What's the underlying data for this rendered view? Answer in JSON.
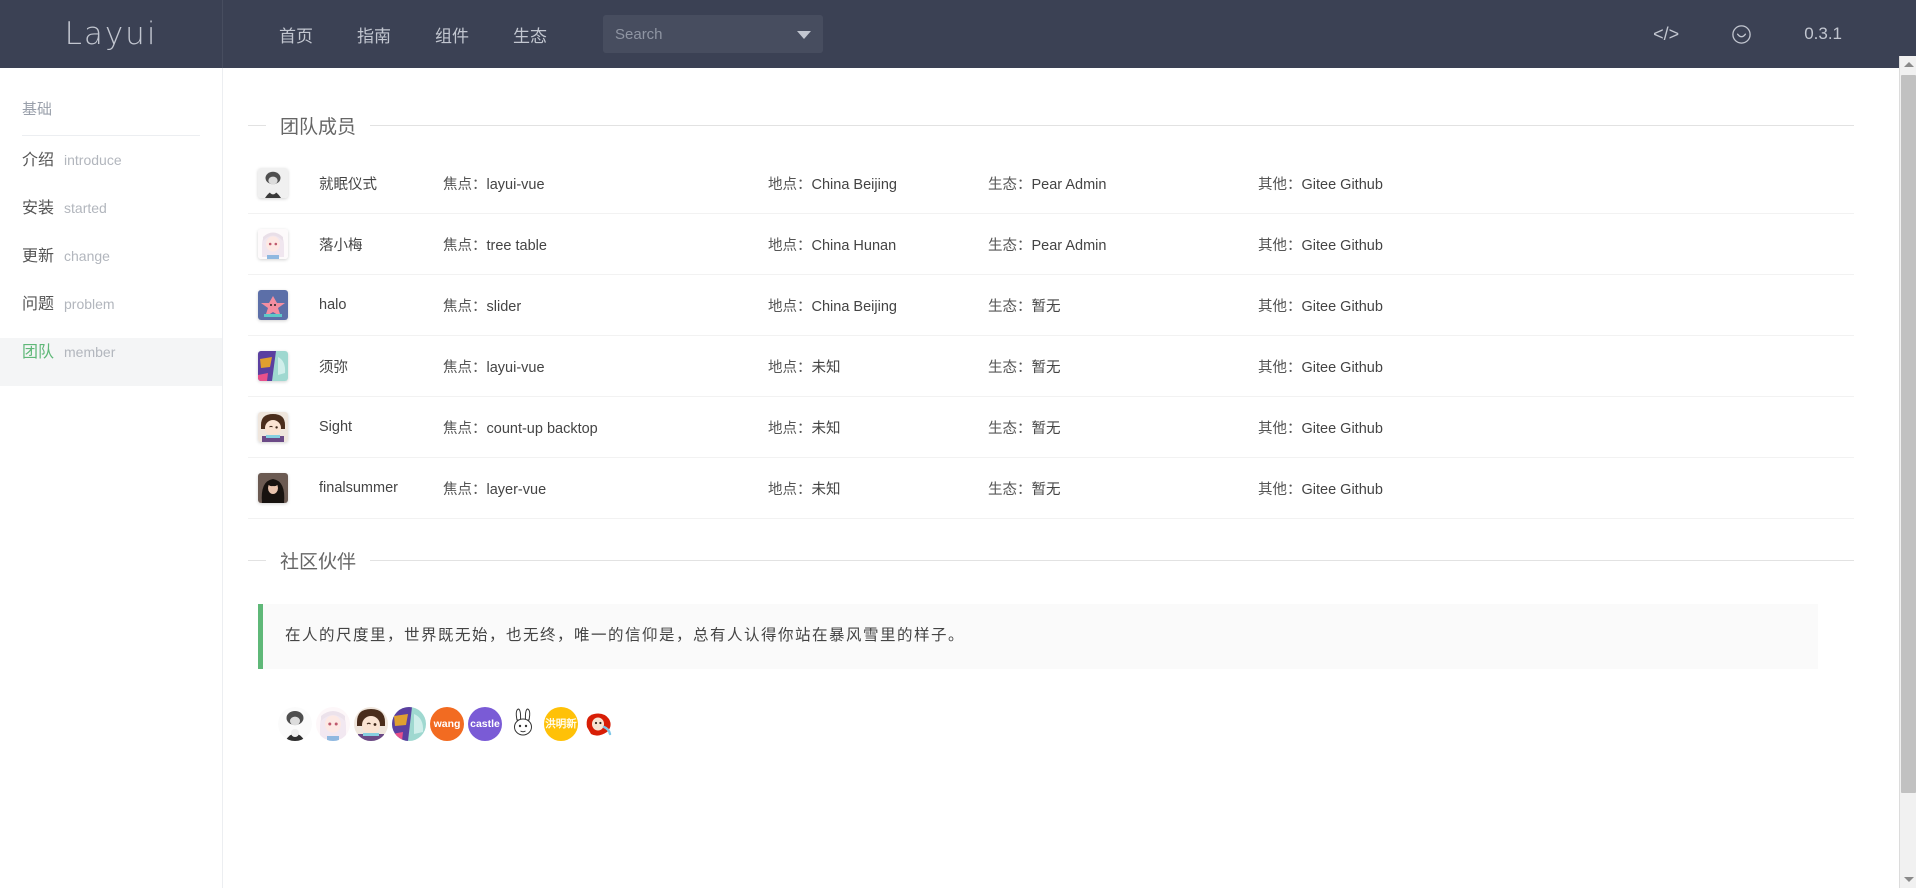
{
  "header": {
    "brand": "Layui",
    "nav": [
      {
        "label": "首页",
        "name": "home"
      },
      {
        "label": "指南",
        "name": "guide"
      },
      {
        "label": "组件",
        "name": "components"
      },
      {
        "label": "生态",
        "name": "ecosystem"
      }
    ],
    "search": {
      "placeholder": "Search",
      "value": ""
    },
    "code_icon": "</>",
    "smile_icon": "smile-face",
    "version": "0.3.1",
    "background": "#3b4154"
  },
  "sidebar": {
    "group_title": "基础",
    "items": [
      {
        "cn": "介绍",
        "en": "introduce",
        "active": false
      },
      {
        "cn": "安装",
        "en": "started",
        "active": false
      },
      {
        "cn": "更新",
        "en": "change",
        "active": false
      },
      {
        "cn": "问题",
        "en": "problem",
        "active": false
      },
      {
        "cn": "团队",
        "en": "member",
        "active": true
      }
    ],
    "active_color": "#5FB878"
  },
  "main": {
    "team_section": {
      "title": "团队成员",
      "labels": {
        "focus": "焦点：",
        "place": "地点：",
        "eco": "生态：",
        "other": "其他："
      },
      "members": [
        {
          "name": "就眠仪式",
          "focus": "layui-vue",
          "place": "China Beijing",
          "eco": "Pear Admin",
          "other": "Gitee Github",
          "avatar": "grayscale-portrait"
        },
        {
          "name": "落小梅",
          "focus": "tree table",
          "place": "China Hunan",
          "eco": "Pear Admin",
          "other": "Gitee Github",
          "avatar": "white-hair-anime-girl"
        },
        {
          "name": "halo",
          "focus": "slider",
          "place": "China Beijing",
          "eco": "暂无",
          "other": "Gitee Github",
          "avatar": "pink-starfish"
        },
        {
          "name": "须弥",
          "focus": "layui-vue",
          "place": "未知",
          "eco": "暂无",
          "other": "Gitee Github",
          "avatar": "colorful-character"
        },
        {
          "name": "Sight",
          "focus": "count-up backtop",
          "place": "未知",
          "eco": "暂无",
          "other": "Gitee Github",
          "avatar": "brown-hair-chibi"
        },
        {
          "name": "finalsummer",
          "focus": "layer-vue",
          "place": "未知",
          "eco": "暂无",
          "other": "Gitee Github",
          "avatar": "dark-hair-woman"
        }
      ]
    },
    "community_section": {
      "title": "社区伙伴",
      "quote": "在人的尺度里，世界既无始，也无终，唯一的信仰是，总有人认得你站在暴风雪里的样子。",
      "quote_accent": "#5FB878",
      "partners": [
        {
          "name": "partner-grayscale-portrait",
          "type": "image",
          "colors": [
            "#f2f2f2",
            "#5a5a5a"
          ],
          "label": ""
        },
        {
          "name": "partner-white-hair-anime",
          "type": "image",
          "colors": [
            "#fdf6f8",
            "#e8b4c6"
          ],
          "label": ""
        },
        {
          "name": "partner-brown-hair-chibi",
          "type": "image",
          "colors": [
            "#3f2a1d",
            "#f6d9c4"
          ],
          "label": ""
        },
        {
          "name": "partner-colorful-character",
          "type": "image",
          "colors": [
            "#5b3fa0",
            "#9fd8d0"
          ],
          "label": ""
        },
        {
          "name": "partner-wang",
          "type": "text",
          "colors": [
            "#f26b21"
          ],
          "label": "wang"
        },
        {
          "name": "partner-castle",
          "type": "text",
          "colors": [
            "#7a5bd6"
          ],
          "label": "castle"
        },
        {
          "name": "partner-bunny",
          "type": "image",
          "colors": [
            "#ffffff",
            "#333333"
          ],
          "label": ""
        },
        {
          "name": "partner-hongmingxin",
          "type": "text",
          "colors": [
            "#ffc107"
          ],
          "label": "洪明新"
        },
        {
          "name": "partner-red-mascot",
          "type": "image",
          "colors": [
            "#ffffff",
            "#d81e06"
          ],
          "label": ""
        }
      ]
    }
  },
  "scrollbar": {
    "name": "vertical-scrollbar",
    "thumb_color": "#c1c1c1"
  }
}
